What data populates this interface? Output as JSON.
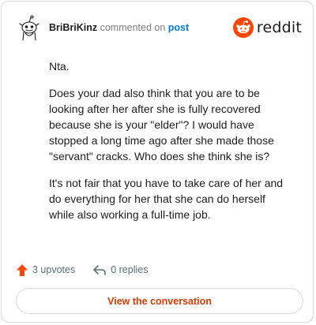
{
  "comment": {
    "username": "BriBriKinz",
    "action_text": "commented on",
    "target_link": "post",
    "paragraphs": [
      "Nta.",
      "Does your dad also think that you are to be looking after her after she is fully recovered because she is your \"elder\"? I would have stopped a long time ago after she made those \"servant\" cracks. Who does she think she is?",
      "It's not fair that you have to take care of her and do everything for her that she can do herself while also working a full-time job."
    ]
  },
  "brand": {
    "name": "reddit",
    "icon": "reddit-logo-icon",
    "color": "#ff4500"
  },
  "actions": {
    "upvotes": "3 upvotes",
    "replies": "0 replies",
    "upvote_icon": "upvote-arrow-icon",
    "reply_icon": "reply-arrow-icon",
    "upvote_color": "#ff4500"
  },
  "cta": {
    "label": "View the conversation",
    "color": "#d93a00"
  },
  "avatar": {
    "icon": "avatar-snoo-icon"
  }
}
